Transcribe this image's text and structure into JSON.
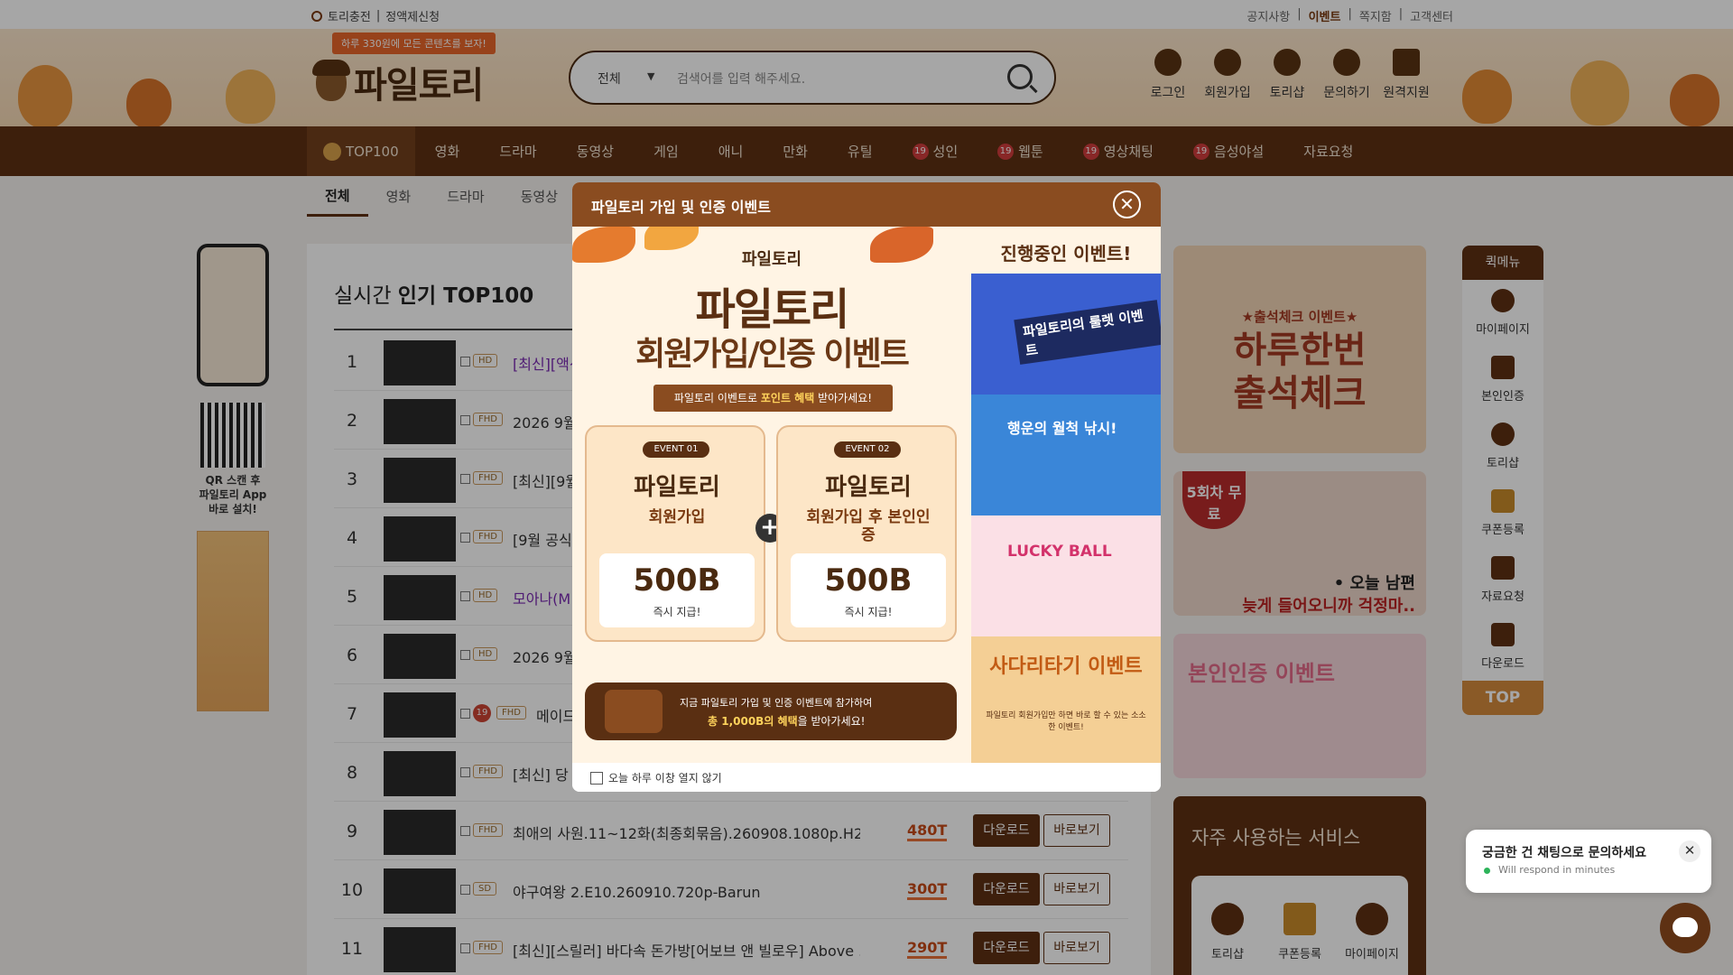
{
  "topbar": {
    "left": [
      "토리충전",
      "정액제신청"
    ],
    "right": [
      "공지사항",
      "이벤트",
      "쪽지함",
      "고객센터"
    ]
  },
  "header": {
    "promo": "하루 330원에 모든 콘텐츠를 보자!",
    "logo": "파일토리",
    "search_category": "전체",
    "search_placeholder": "검색어를 입력 해주세요.",
    "icons": [
      {
        "label": "로그인",
        "icon": "person-icon"
      },
      {
        "label": "회원가입",
        "icon": "user-add-icon"
      },
      {
        "label": "토리샵",
        "icon": "tori-shop-icon"
      },
      {
        "label": "문의하기",
        "icon": "headset-icon"
      },
      {
        "label": "원격지원",
        "icon": "remote-help-icon"
      }
    ]
  },
  "nav": {
    "items": [
      "TOP100",
      "영화",
      "드라마",
      "동영상",
      "게임",
      "애니",
      "만화",
      "유틸",
      "성인",
      "웹툰",
      "영상채팅",
      "음성야설",
      "자료요청"
    ],
    "badge19": "19"
  },
  "subtabs": [
    "전체",
    "영화",
    "드라마",
    "동영상"
  ],
  "leftside": {
    "qr_text": [
      "QR 스캔 후",
      "파일토리 App",
      "바로 설치!"
    ]
  },
  "main": {
    "title_prefix": "실시간 ",
    "title_bold": "인기 TOP100",
    "rows": [
      {
        "rank": "1",
        "quality": "HD",
        "title": "[최신][액션]",
        "highlight": true
      },
      {
        "rank": "2",
        "quality": "FHD",
        "title": "2026 9월"
      },
      {
        "rank": "3",
        "quality": "FHD",
        "title": "[최신][9월"
      },
      {
        "rank": "4",
        "quality": "FHD",
        "title": "[9월 공식"
      },
      {
        "rank": "5",
        "quality": "HD",
        "title": "모아나(M",
        "highlight": true
      },
      {
        "rank": "6",
        "quality": "HD",
        "title": "2026 9월"
      },
      {
        "rank": "7",
        "quality": "FHD",
        "title": "메이드",
        "adult": true
      },
      {
        "rank": "8",
        "quality": "FHD",
        "title": "[최신] 당"
      },
      {
        "rank": "9",
        "quality": "FHD",
        "title": "최애의 사원.11~12화(최종회묶음).260908.1080p.H26...",
        "size": "480T",
        "download": "다운로드",
        "view": "바로보기"
      },
      {
        "rank": "10",
        "quality": "SD",
        "title": "야구여왕 2.E10.260910.720p-Barun",
        "size": "300T",
        "download": "다운로드",
        "view": "바로보기"
      },
      {
        "rank": "11",
        "quality": "FHD",
        "title": "[최신][스릴러] 바다속 돈가방[어보브 앤 빌로우] Above ...",
        "size": "290T",
        "download": "다운로드",
        "view": "바로보기"
      }
    ]
  },
  "rightside": {
    "attend_small": "★출석체크 이벤트★",
    "attend_big": [
      "하루한번",
      "출석체크"
    ],
    "webtoon_badge": "5회차 무료",
    "webtoon_lines": [
      "• 오늘 남편",
      "늦게 들어오니까 걱정마.."
    ],
    "verify_title": "본인인증 이벤트",
    "service_title": "자주 사용하는 서비스",
    "services": [
      "토리샵",
      "쿠폰등록",
      "마이페이지"
    ]
  },
  "quick": {
    "title": "퀵메뉴",
    "items": [
      "마이페이지",
      "본인인증",
      "토리샵",
      "쿠폰등록",
      "자료요청",
      "다운로드"
    ],
    "top": "TOP"
  },
  "modal": {
    "title": "파일토리 가입 및 인증 이벤트",
    "brand": "파일토리",
    "headline1": "파일토리",
    "headline2": "회원가입/인증 이벤트",
    "ribbon_pre": "파일토리 이벤트로 ",
    "ribbon_bold": "포인트 혜택",
    "ribbon_post": " 받아가세요!",
    "cards": [
      {
        "tag": "EVENT 01",
        "title": "파일토리",
        "sub": "회원가입",
        "amount": "500B",
        "note": "즉시 지급!"
      },
      {
        "tag": "EVENT 02",
        "title": "파일토리",
        "sub": "회원가입 후 본인인증",
        "amount": "500B",
        "note": "즉시 지급!"
      }
    ],
    "wallet_line1": "지금 파일토리 가입 및 인증 이벤트에 참가하여",
    "wallet_bold": "총 1,000B의 혜택",
    "wallet_post": "을 받아가세요!",
    "side_heading": "진행중인 이벤트!",
    "side_events": [
      {
        "title": "파일토리의 룰렛 이벤트"
      },
      {
        "title": "행운의 월척 낚시!"
      },
      {
        "title": "LUCKY BALL"
      },
      {
        "title": "사다리타기 이벤트",
        "sub": "파일토리 회원가입만 하면 바로 할 수 있는 소소한 이벤트!"
      }
    ],
    "footer_checkbox": "오늘 하루 이창 열지 않기"
  },
  "chat": {
    "title": "궁금한 건 채팅으로 문의하세요",
    "status": "Will respond in minutes"
  }
}
